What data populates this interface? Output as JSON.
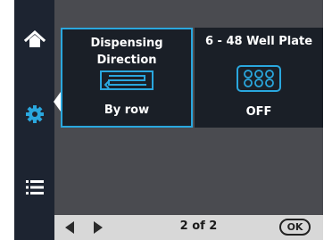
{
  "tiles": [
    {
      "title": "Dispensing Direction",
      "value": "By row",
      "icon": "row-direction-icon",
      "selected": true
    },
    {
      "title": "6 - 48 Well Plate",
      "value": "OFF",
      "icon": "well-plate-icon",
      "selected": false
    }
  ],
  "sidebar": {
    "items": [
      {
        "icon": "home-icon"
      },
      {
        "icon": "settings-gear-icon",
        "active": true
      },
      {
        "icon": "list-icon"
      }
    ]
  },
  "pager": {
    "current": "2 of 2",
    "ok_label": "OK"
  },
  "colors": {
    "accent": "#2aa7de",
    "sidebar": "#1d2431",
    "tile": "#1a1f27",
    "background": "#4a4b50",
    "bottombar": "#d8d8d8"
  }
}
